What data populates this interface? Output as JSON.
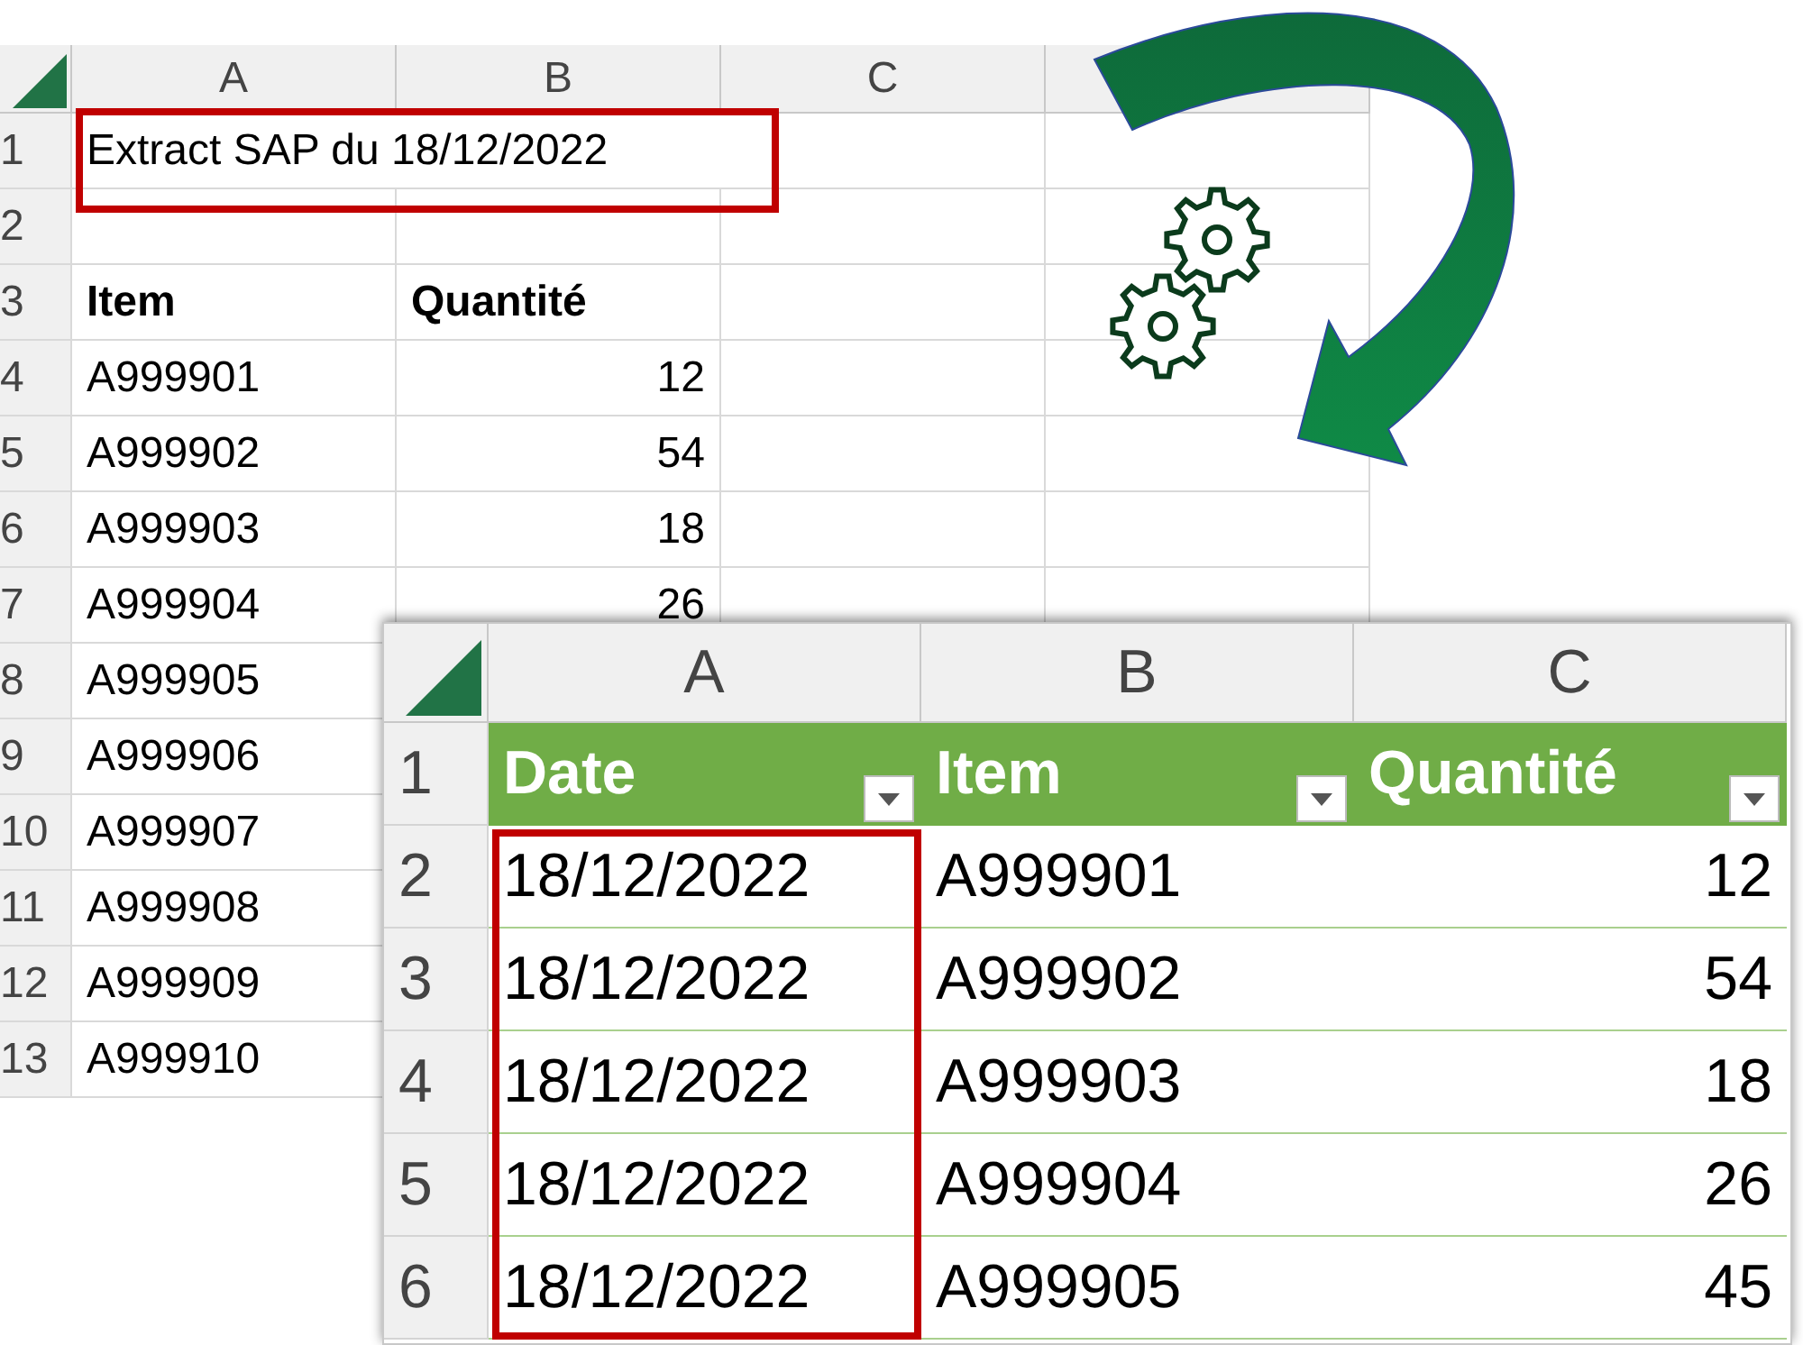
{
  "source_sheet": {
    "column_letters": [
      "A",
      "B",
      "C"
    ],
    "row_numbers": [
      "1",
      "2",
      "3",
      "4",
      "5",
      "6",
      "7",
      "8",
      "9",
      "10",
      "11",
      "12",
      "13"
    ],
    "title": {
      "text": "Extract SAP du 18/12/2022",
      "highlighted": true
    },
    "headers": [
      "Item",
      "Quantité"
    ],
    "rows": [
      {
        "item": "A999901",
        "quantity": "12"
      },
      {
        "item": "A999902",
        "quantity": "54"
      },
      {
        "item": "A999903",
        "quantity": "18"
      },
      {
        "item": "A999904",
        "quantity": "26"
      },
      {
        "item": "A999905"
      },
      {
        "item": "A999906"
      },
      {
        "item": "A999907"
      },
      {
        "item": "A999908"
      },
      {
        "item": "A999909"
      },
      {
        "item": "A999910"
      }
    ]
  },
  "result_sheet": {
    "column_letters": [
      "A",
      "B",
      "C"
    ],
    "row_numbers": [
      "1",
      "2",
      "3",
      "4",
      "5",
      "6"
    ],
    "columns": [
      {
        "header": "Date",
        "highlighted": true,
        "kind": "text"
      },
      {
        "header": "Item",
        "highlighted": false,
        "kind": "text"
      },
      {
        "header": "Quantité",
        "highlighted": false,
        "kind": "number"
      }
    ],
    "rows": [
      [
        "18/12/2022",
        "A999901",
        "12"
      ],
      [
        "18/12/2022",
        "A999902",
        "54"
      ],
      [
        "18/12/2022",
        "A999903",
        "18"
      ],
      [
        "18/12/2022",
        "A999904",
        "26"
      ],
      [
        "18/12/2022",
        "A999905",
        "45"
      ]
    ]
  }
}
